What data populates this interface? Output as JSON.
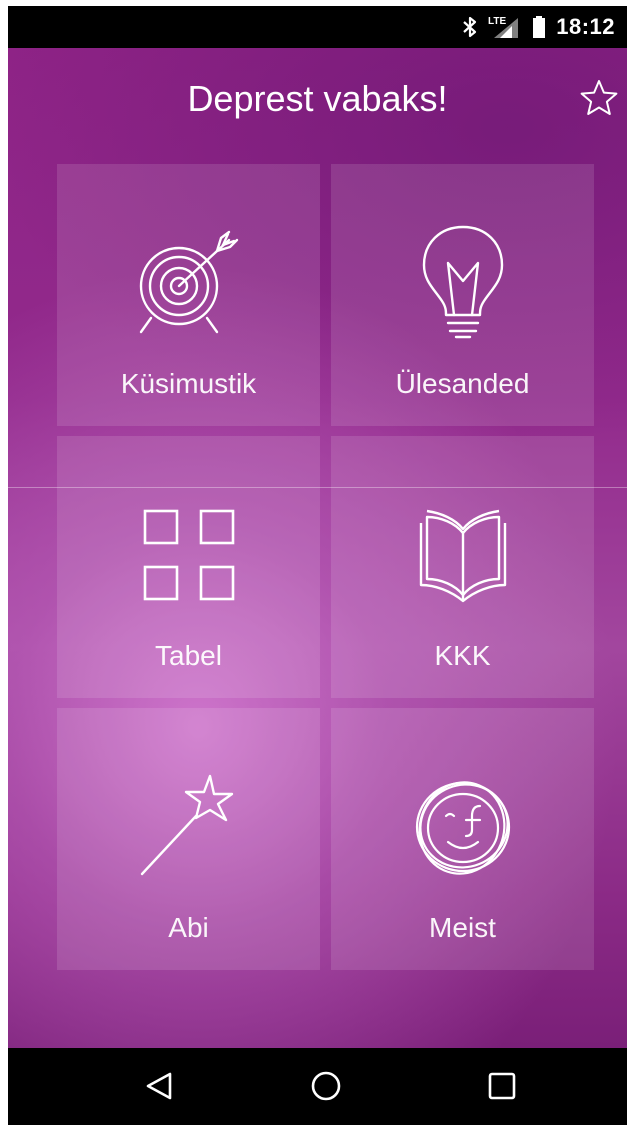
{
  "status_bar": {
    "time": "18:12",
    "icons": [
      "bluetooth-icon",
      "lte-signal-icon",
      "battery-icon"
    ]
  },
  "app": {
    "title": "Deprest vabaks!",
    "favorite_icon": "star-outline-icon"
  },
  "tiles": [
    {
      "label": "Küsimustik",
      "icon": "target-arrow-icon"
    },
    {
      "label": "Ülesanded",
      "icon": "lightbulb-icon"
    },
    {
      "label": "Tabel",
      "icon": "grid-squares-icon"
    },
    {
      "label": "KKK",
      "icon": "open-book-icon"
    },
    {
      "label": "Abi",
      "icon": "magic-wand-icon"
    },
    {
      "label": "Meist",
      "icon": "face-logo-icon"
    }
  ],
  "nav_bar": {
    "buttons": [
      "back-icon",
      "home-icon",
      "recents-icon"
    ]
  },
  "colors": {
    "background_primary": "#8e2386",
    "background_glow": "#c06cbf",
    "tile_overlay": "rgba(255,255,255,0.12)",
    "text": "#ffffff",
    "system_bars": "#000000"
  }
}
